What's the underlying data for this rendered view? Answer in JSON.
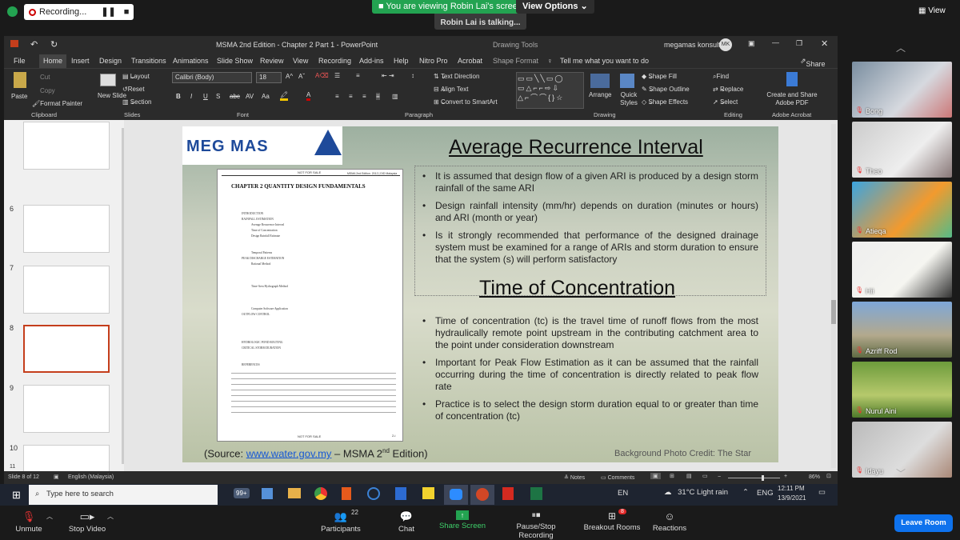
{
  "zoom": {
    "recording": "Recording...",
    "banner": "You are viewing Robin Lai's screen",
    "view_options": "View Options",
    "talking": "Robin Lai is talking...",
    "view": "View",
    "bottom": [
      {
        "label": "Unmute"
      },
      {
        "label": "Stop Video"
      },
      {
        "label": "Participants",
        "count": "22"
      },
      {
        "label": "Chat"
      },
      {
        "label": "Share Screen"
      },
      {
        "label": "Pause/Stop Recording"
      },
      {
        "label": "Breakout Rooms",
        "badge": "8"
      },
      {
        "label": "Reactions"
      }
    ],
    "leave": "Leave Room",
    "participants": [
      "Bong",
      "Theo",
      "Atieqa",
      "Hii",
      "Azriff Rod",
      "Nurul Aini",
      "Idayu"
    ]
  },
  "ppt": {
    "title": "MSMA 2nd Edition - Chapter 2 Part 1  -  PowerPoint",
    "drawing_tools": "Drawing Tools",
    "user": "megamas konsult",
    "user_initials": "MK",
    "tabs": [
      "File",
      "Home",
      "Insert",
      "Design",
      "Transitions",
      "Animations",
      "Slide Show",
      "Review",
      "View",
      "Recording",
      "Add-ins",
      "Help",
      "Nitro Pro",
      "Acrobat",
      "Shape Format"
    ],
    "tell_me": "Tell me what you want to do",
    "share": "Share",
    "ribbon": {
      "paste": "Paste",
      "cut": "Cut",
      "copy": "Copy",
      "format_painter": "Format Painter",
      "clipboard": "Clipboard",
      "new_slide": "New Slide",
      "layout": "Layout",
      "reset": "Reset",
      "section": "Section",
      "slides": "Slides",
      "font_name": "Calibri (Body)",
      "font_size": "18",
      "font": "Font",
      "text_direction": "Text Direction",
      "align_text": "Align Text",
      "smartart": "Convert to SmartArt",
      "paragraph": "Paragraph",
      "arrange": "Arrange",
      "quick_styles": "Quick Styles",
      "shape_fill": "Shape Fill",
      "shape_outline": "Shape Outline",
      "shape_effects": "Shape Effects",
      "drawing": "Drawing",
      "find": "Find",
      "replace": "Replace",
      "select": "Select",
      "editing": "Editing",
      "create_share": "Create and Share Adobe PDF",
      "adobe": "Adobe Acrobat"
    },
    "thumb_numbers": [
      "6",
      "7",
      "8",
      "9",
      "10",
      "11"
    ],
    "status": {
      "slide": "Slide 8 of 12",
      "lang": "English (Malaysia)",
      "notes": "Notes",
      "comments": "Comments",
      "zoom": "86%"
    }
  },
  "slide": {
    "logo_text": "MEG  MAS",
    "doc": {
      "top_left": "NOT FOR SALE",
      "top_right": "MSMA 2nd Edition. 2012 | DID Malaysia",
      "heading": "CHAPTER 2    QUANTITY DESIGN FUNDAMENTALS",
      "lines": [
        "INTRODUCTION",
        "RAINFALL ESTIMATION",
        "Average Recurrence Interval",
        "Time of Concentration",
        "Design Rainfall Estimate",
        "Temporal Patterns",
        "PEAK DISCHARGE ESTIMATION",
        "Rational Method",
        "Time-Area Hydrograph Method",
        "Computer Software Application",
        "OUTFLOW CONTROL",
        "HYDROLOGIC POND ROUTING",
        "CRITICAL STORM DURATION",
        "REFERENCES"
      ],
      "footer": "NOT FOR SALE",
      "page": "2-i"
    },
    "heading1": "Average Recurrence Interval",
    "bullets1": [
      "It is assumed that design flow of a given ARI is produced by a design storm rainfall of the same ARI",
      "Design rainfall intensity (mm/hr) depends on duration (minutes or hours) and ARI (month or year)",
      "Is it strongly recommended that performance of the designed drainage system must be examined for a range of ARIs and storm duration to ensure that the system (s) will perform satisfactory"
    ],
    "heading2": "Time of Concentration",
    "bullets2": [
      "Time of concentration (tc) is the travel time of runoff flows from the most hydraulically remote point upstream in the contributing catchment area to the point under consideration downstream",
      "Important for Peak Flow Estimation as it can be assumed that the rainfall occurring during the time of concentration is directly related to peak flow rate",
      "Practice is to select the design storm duration equal to or greater than time of concentration (tc)"
    ],
    "source_prefix": "(Source: ",
    "source_link": "www.water.gov.my",
    "source_mid": " – MSMA 2",
    "source_sup": "nd",
    "source_suffix": " Edition)",
    "credit": "Background Photo Credit: The Star"
  },
  "taskbar": {
    "search": "Type here to search",
    "weather": "31°C  Light rain",
    "lang": "ENG",
    "time": "12:11 PM",
    "date": "13/9/2021",
    "badge": "99+",
    "en": "EN"
  },
  "colors": {
    "banner": "#23a351",
    "leave": "#0e72ed",
    "accent": "#c43e1c"
  }
}
